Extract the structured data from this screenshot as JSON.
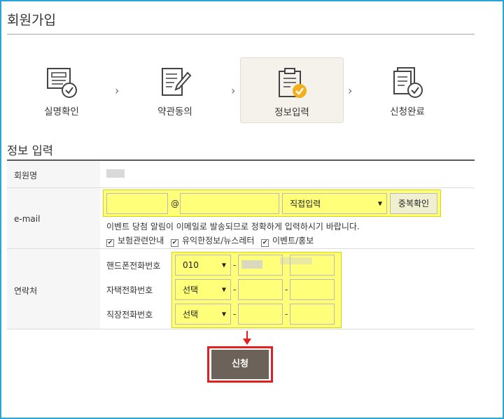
{
  "page": {
    "title": "회원가입",
    "section_title": "정보 입력"
  },
  "steps": [
    {
      "label": "실명확인",
      "icon": "id-card-check-icon",
      "active": false
    },
    {
      "label": "약관동의",
      "icon": "document-pen-icon",
      "active": false
    },
    {
      "label": "정보입력",
      "icon": "clipboard-check-icon",
      "active": true
    },
    {
      "label": "신청완료",
      "icon": "documents-check-icon",
      "active": false
    }
  ],
  "form": {
    "member_name": {
      "label": "회원명"
    },
    "email": {
      "label": "e-mail",
      "local_value": "",
      "at": "@",
      "domain_value": "",
      "domain_select": "직접입력",
      "dup_check_label": "중복확인",
      "notice": "이벤트 당첨 알림이 이메일로 발송되므로 정확하게 입력하시기 바랍니다.",
      "checkboxes": [
        {
          "label": "보험관련안내",
          "checked": true
        },
        {
          "label": "유익한정보/뉴스레터",
          "checked": true
        },
        {
          "label": "이벤트/홍보",
          "checked": true
        }
      ]
    },
    "contact": {
      "label": "연락처",
      "dash": "-",
      "rows": [
        {
          "label": "핸드폰전화번호",
          "prefix": "010"
        },
        {
          "label": "자택전화번호",
          "prefix": "선택"
        },
        {
          "label": "직장전화번호",
          "prefix": "선택"
        }
      ]
    }
  },
  "submit": {
    "label": "신청"
  },
  "colors": {
    "accent_yellow": "#ffff7a",
    "submit_bg": "#6d6259",
    "highlight_red": "#e32020",
    "frame_blue": "#2aa5d9",
    "check_orange": "#f2b01e"
  }
}
